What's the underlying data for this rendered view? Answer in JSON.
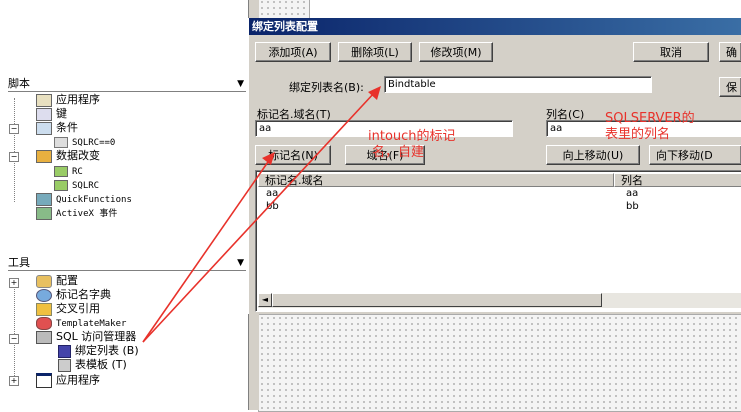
{
  "explorer": {
    "scripts_header": "脚本",
    "scripts_items": [
      {
        "label": "应用程序"
      },
      {
        "label": "键"
      },
      {
        "label": "条件"
      },
      {
        "label": "SQLRC==0"
      },
      {
        "label": "数据改变"
      },
      {
        "label": "RC"
      },
      {
        "label": "SQLRC"
      },
      {
        "label": "QuickFunctions"
      },
      {
        "label": "ActiveX 事件"
      }
    ],
    "tools_header": "工具",
    "tools_items": [
      {
        "label": "配置"
      },
      {
        "label": "标记名字典"
      },
      {
        "label": "交叉引用"
      },
      {
        "label": "TemplateMaker"
      },
      {
        "label": "SQL 访问管理器"
      },
      {
        "label": "绑定列表 (B)"
      },
      {
        "label": "表模板 (T)"
      },
      {
        "label": "应用程序"
      }
    ]
  },
  "dialog": {
    "title": "绑定列表配置",
    "add_btn": "添加项(A)",
    "delete_btn": "删除项(L)",
    "modify_btn": "修改项(M)",
    "cancel_btn": "取消",
    "confirm_btn_partial": "确",
    "save_btn_partial": "保",
    "bind_list_label": "绑定列表名(B):",
    "bind_list_value": "Bindtable",
    "tagname_label": "标记名.域名(T)",
    "tagname_value": "aa",
    "column_label": "列名(C)",
    "column_value": "aa",
    "tagname_btn": "标记名(N)",
    "field_btn": "域名(F)",
    "move_up_btn": "向上移动(U)",
    "move_down_btn": "向下移动(D",
    "table": {
      "headers": [
        "标记名.域名",
        "列名"
      ],
      "rows": [
        [
          "aa",
          "aa"
        ],
        [
          "bb",
          "bb"
        ]
      ]
    }
  },
  "annotations": {
    "note_tag_line1": "intouch的标记",
    "note_tag_line2": "名，自建",
    "note_col_line1": "SQLSERVER的",
    "note_col_line2": "表里的列名",
    "color": "#e8322b"
  }
}
